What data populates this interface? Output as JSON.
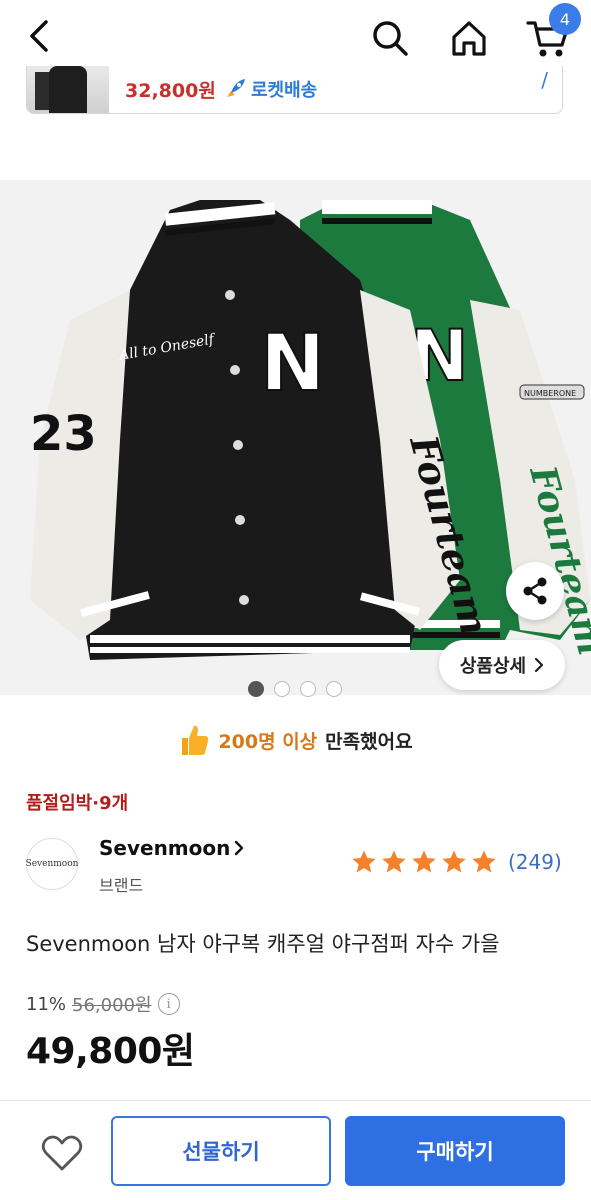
{
  "header": {
    "cart_count": "4"
  },
  "mini_card": {
    "price": "32,800원",
    "shipping": "로켓배송"
  },
  "image": {
    "detail_label": "상품상세",
    "carousel_total": 4,
    "carousel_active": 1,
    "jacket_number": "23",
    "jacket_letter": "N",
    "jacket_sleeve_text": "Fourteam",
    "jacket_script": "All to Oneself",
    "patch_text": "NUMBERONE"
  },
  "satisfaction": {
    "highlight": "200명 이상",
    "rest": "만족했어요"
  },
  "product": {
    "stock_notice": "품절임박·9개",
    "brand_logo_text": "Sevenmoon",
    "brand_name": "Sevenmoon",
    "brand_sub": "브랜드",
    "rating_count": "(249)",
    "rating_stars": 5,
    "title": "Sevenmoon 남자 야구복 캐주얼 야구점퍼 자수 가을",
    "discount_rate": "11%",
    "original_price": "56,000원",
    "sale_price": "49,800원"
  },
  "bottom_bar": {
    "gift_label": "선물하기",
    "buy_label": "구매하기"
  },
  "colors": {
    "accent_blue": "#2f6fe4",
    "price_red": "#c9302c",
    "stock_red": "#b21f1b",
    "star_orange": "#f5822a",
    "jacket_black": "#1a1a1a",
    "jacket_green": "#1a7a3c"
  }
}
